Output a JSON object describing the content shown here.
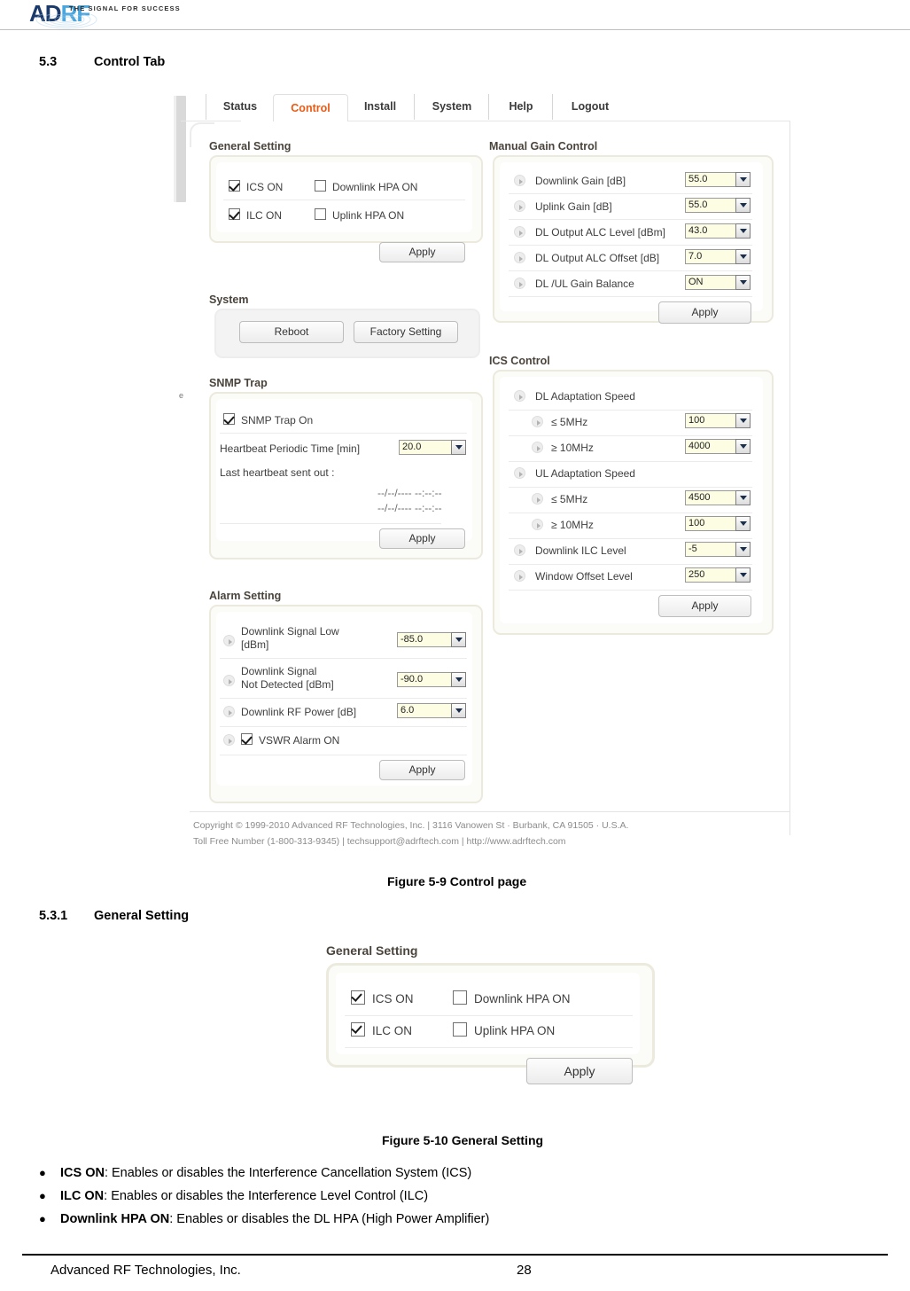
{
  "brand": {
    "logo_main": "AD",
    "logo_accent": "RF",
    "tagline": "THE SIGNAL FOR SUCCESS"
  },
  "document": {
    "section_number": "5.3",
    "section_title": "Control Tab",
    "figure_59": "Figure 5-9      Control page",
    "subsection_number": "5.3.1",
    "subsection_title": "General Setting",
    "figure_510": "Figure 5-10   General Setting",
    "bullets": [
      {
        "term": "ICS ON",
        "desc": ": Enables or disables the Interference Cancellation System (ICS)"
      },
      {
        "term": "ILC ON",
        "desc": ": Enables or disables the Interference Level Control (ILC)"
      },
      {
        "term": "Downlink HPA ON",
        "desc": ": Enables or disables the DL HPA (High Power Amplifier)"
      }
    ],
    "footer_company": "Advanced RF Technologies, Inc.",
    "footer_page": "28",
    "stray_char": "e"
  },
  "webui": {
    "tabs": [
      {
        "label": "Status",
        "active": false
      },
      {
        "label": "Control",
        "active": true
      },
      {
        "label": "Install",
        "active": false
      },
      {
        "label": "System",
        "active": false
      },
      {
        "label": "Help",
        "active": false
      },
      {
        "label": "Logout",
        "active": false
      }
    ],
    "active_tab_color": "#ea5a13",
    "general_setting": {
      "title": "General Setting",
      "checkboxes": [
        {
          "label": "ICS ON",
          "checked": true
        },
        {
          "label": "Downlink HPA ON",
          "checked": false
        },
        {
          "label": "ILC ON",
          "checked": true
        },
        {
          "label": "Uplink HPA ON",
          "checked": false
        }
      ],
      "apply_label": "Apply"
    },
    "system": {
      "title": "System",
      "reboot_label": "Reboot",
      "factory_label": "Factory Setting"
    },
    "snmp_trap": {
      "title": "SNMP Trap",
      "on_label": "SNMP Trap On",
      "on_checked": true,
      "heartbeat_label": "Heartbeat Periodic Time [min]",
      "heartbeat_value": "20.0",
      "last_sent_label": "Last heartbeat sent out :",
      "last_sent_values": [
        "--/--/---- --:--:--",
        "--/--/---- --:--:--"
      ],
      "apply_label": "Apply"
    },
    "alarm_setting": {
      "title": "Alarm Setting",
      "rows": [
        {
          "label_line1": "Downlink Signal Low",
          "label_line2": "[dBm]",
          "value": "-85.0"
        },
        {
          "label_line1": "Downlink Signal",
          "label_line2": "Not Detected [dBm]",
          "value": "-90.0"
        },
        {
          "label_line1": "Downlink RF Power [dB]",
          "label_line2": "",
          "value": "6.0"
        }
      ],
      "vswr_label": "VSWR Alarm ON",
      "vswr_checked": true,
      "apply_label": "Apply"
    },
    "manual_gain_control": {
      "title": "Manual Gain Control",
      "rows": [
        {
          "label": "Downlink Gain [dB]",
          "value": "55.0"
        },
        {
          "label": "Uplink Gain [dB]",
          "value": "55.0"
        },
        {
          "label": "DL Output ALC Level [dBm]",
          "value": "43.0"
        },
        {
          "label": "DL Output ALC Offset [dB]",
          "value": "7.0"
        },
        {
          "label": "DL /UL Gain Balance",
          "value": "ON"
        }
      ],
      "apply_label": "Apply"
    },
    "ics_control": {
      "title": "ICS Control",
      "rows": [
        {
          "label": "DL Adaptation Speed",
          "value": "",
          "indent": 0
        },
        {
          "label": "≤ 5MHz",
          "value": "100",
          "indent": 1
        },
        {
          "label": "≥ 10MHz",
          "value": "4000",
          "indent": 1
        },
        {
          "label": "UL Adaptation Speed",
          "value": "",
          "indent": 0
        },
        {
          "label": "≤ 5MHz",
          "value": "4500",
          "indent": 1
        },
        {
          "label": "≥ 10MHz",
          "value": "100",
          "indent": 1
        },
        {
          "label": "Downlink ILC Level",
          "value": "-5",
          "indent": 0
        },
        {
          "label": "Window Offset Level",
          "value": "250",
          "indent": 0
        }
      ],
      "apply_label": "Apply"
    },
    "footer": {
      "line1": "Copyright © 1999-2010 Advanced RF Technologies, Inc.  |  3116 Vanowen St · Burbank, CA 91505 · U.S.A.",
      "line2": "Toll Free Number (1-800-313-9345) | techsupport@adrftech.com | http://www.adrftech.com"
    }
  },
  "figure510": {
    "title": "General Setting",
    "checkboxes": [
      {
        "label": "ICS ON",
        "checked": true
      },
      {
        "label": "Downlink HPA ON",
        "checked": false
      },
      {
        "label": "ILC ON",
        "checked": true
      },
      {
        "label": "Uplink HPA ON",
        "checked": false
      }
    ],
    "apply_label": "Apply"
  }
}
